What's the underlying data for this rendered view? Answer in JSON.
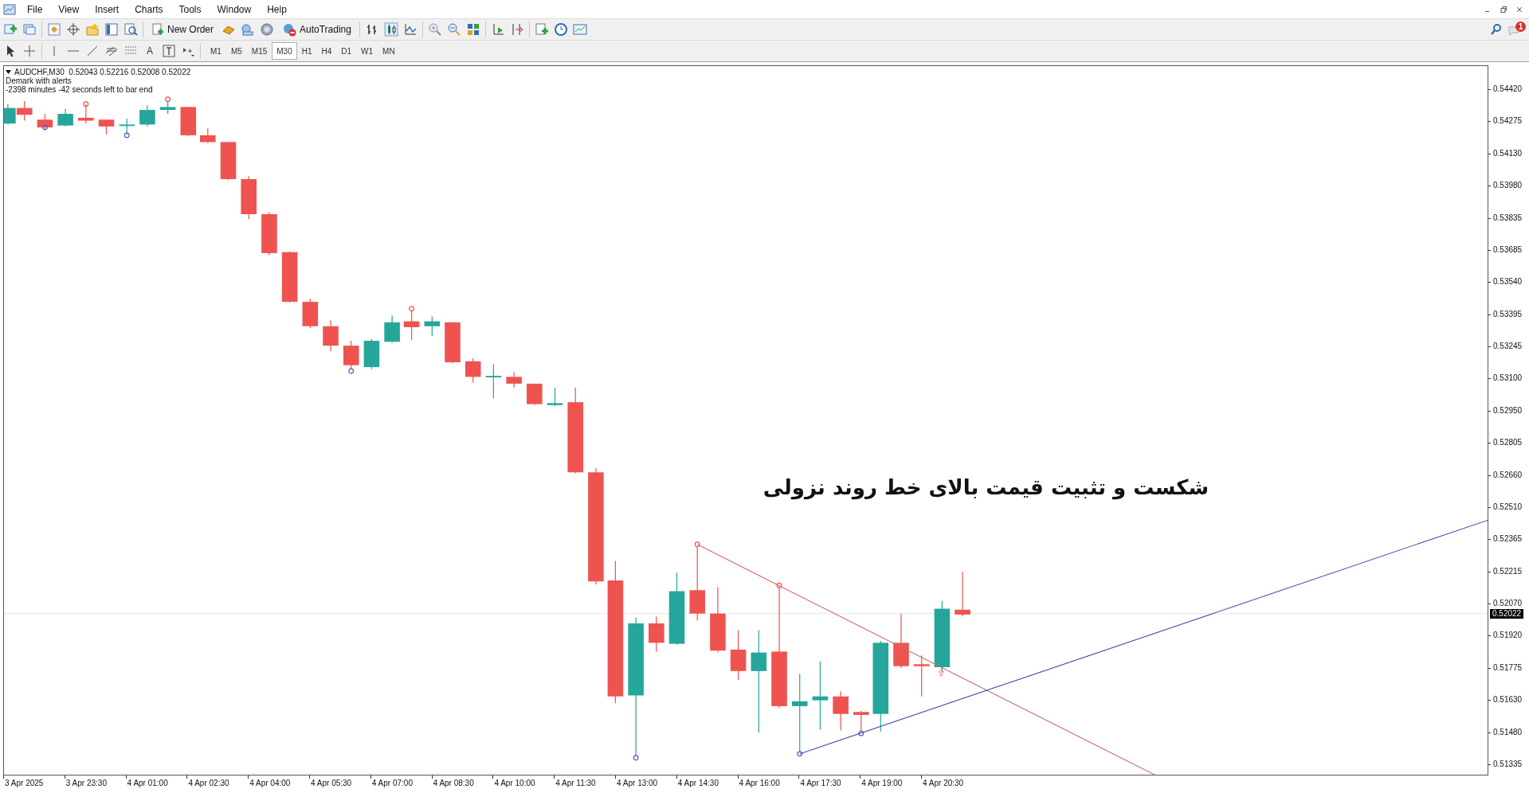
{
  "menu": [
    "File",
    "View",
    "Insert",
    "Charts",
    "Tools",
    "Window",
    "Help"
  ],
  "toolbar": {
    "new_order": "New Order",
    "auto_trading": "AutoTrading"
  },
  "drawing_tools": {
    "text_tool": "A"
  },
  "timeframes": [
    {
      "label": "M1",
      "selected": false
    },
    {
      "label": "M5",
      "selected": false
    },
    {
      "label": "M15",
      "selected": false
    },
    {
      "label": "M30",
      "selected": true
    },
    {
      "label": "H1",
      "selected": false
    },
    {
      "label": "H4",
      "selected": false
    },
    {
      "label": "D1",
      "selected": false
    },
    {
      "label": "W1",
      "selected": false
    },
    {
      "label": "MN",
      "selected": false
    }
  ],
  "notifications": {
    "count": "1"
  },
  "chart": {
    "symbol_line": "AUDCHF,M30  0.52043 0.52216 0.52008 0.52022",
    "indicator": "Demark with alerts",
    "timer": "-2398 minutes -42 seconds left to bar end",
    "annotation": "شکست و تثبیت قیمت بالای خط روند نزولی",
    "price_labels": [
      "0.54420",
      "0.54275",
      "0.54130",
      "0.53980",
      "0.53835",
      "0.53685",
      "0.53540",
      "0.53395",
      "0.53245",
      "0.53100",
      "0.52950",
      "0.52805",
      "0.52660",
      "0.52510",
      "0.52365",
      "0.52215",
      "0.52070",
      "0.51920",
      "0.51775",
      "0.51630",
      "0.51480",
      "0.51335"
    ],
    "current_price": "0.52022",
    "time_labels": [
      "3 Apr 2025",
      "3 Apr 23:30",
      "4 Apr 01:00",
      "4 Apr 02:30",
      "4 Apr 04:00",
      "4 Apr 05:30",
      "4 Apr 07:00",
      "4 Apr 08:30",
      "4 Apr 10:00",
      "4 Apr 11:30",
      "4 Apr 13:00",
      "4 Apr 14:30",
      "4 Apr 16:00",
      "4 Apr 17:30",
      "4 Apr 19:00",
      "4 Apr 20:30"
    ]
  }
}
